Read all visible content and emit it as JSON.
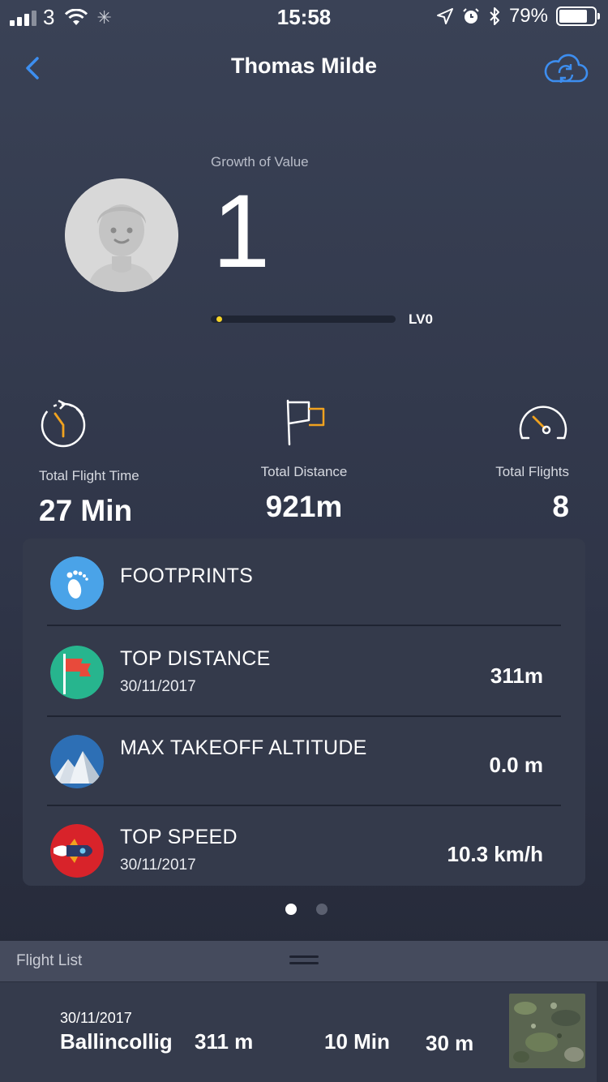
{
  "status_bar": {
    "carrier": "3",
    "time": "15:58",
    "battery": "79%"
  },
  "nav": {
    "title": "Thomas Milde",
    "back_icon": "chevron-left-icon",
    "sync_icon": "cloud-sync-icon"
  },
  "profile": {
    "growth_label": "Growth of Value",
    "growth_value": "1",
    "level_label": "LV0",
    "level_progress": 0.02
  },
  "stats": [
    {
      "icon": "stopwatch-icon",
      "label": "Total Flight Time",
      "value": "27 Min"
    },
    {
      "icon": "flag-icon",
      "label": "Total Distance",
      "value": "921m"
    },
    {
      "icon": "speedometer-icon",
      "label": "Total Flights",
      "value": "8"
    }
  ],
  "records": {
    "footprints": {
      "title": "FOOTPRINTS",
      "icon": "footprint-icon"
    },
    "top_distance": {
      "title": "TOP DISTANCE",
      "date": "30/11/2017",
      "value": "311m",
      "icon": "red-flag-icon"
    },
    "max_altitude": {
      "title": "MAX TAKEOFF ALTITUDE",
      "value": "0.0 m",
      "icon": "mountain-icon"
    },
    "top_speed": {
      "title": "TOP SPEED",
      "date": "30/11/2017",
      "value": "10.3 km/h",
      "icon": "rocket-icon"
    }
  },
  "pager": {
    "pages": 2,
    "active": 0
  },
  "flight_list": {
    "title": "Flight List",
    "items": [
      {
        "date": "30/11/2017",
        "location": "Ballincollig",
        "distance": "311 m",
        "duration": "10 Min",
        "altitude": "30 m"
      }
    ]
  },
  "colors": {
    "accent_blue": "#3d8ef0",
    "level_dot": "#f5d327",
    "icon_orange": "#f0a21f"
  }
}
